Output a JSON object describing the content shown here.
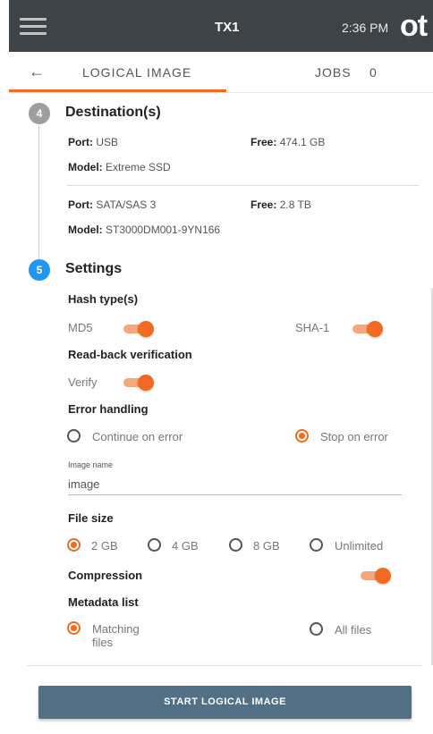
{
  "topbar": {
    "title": "TX1",
    "time": "2:36 PM",
    "logo": "ot"
  },
  "tabs": {
    "back_icon": "back-arrow-icon",
    "logical": "LOGICAL IMAGE",
    "jobs": "JOBS",
    "jobs_count": "0"
  },
  "destinations": {
    "step": "4",
    "title": "Destination(s)",
    "items": [
      {
        "port_label": "Port:",
        "port": "USB",
        "free_label": "Free:",
        "free": "474.1 GB",
        "model_label": "Model:",
        "model": "Extreme SSD"
      },
      {
        "port_label": "Port:",
        "port": "SATA/SAS 3",
        "free_label": "Free:",
        "free": "2.8 TB",
        "model_label": "Model:",
        "model": "ST3000DM001-9YN166"
      }
    ]
  },
  "settings": {
    "step": "5",
    "title": "Settings",
    "hash_heading": "Hash type(s)",
    "hash_md5": "MD5",
    "hash_sha1": "SHA-1",
    "readback_heading": "Read-back verification",
    "verify": "Verify",
    "error_heading": "Error handling",
    "continue_on_error": "Continue on error",
    "stop_on_error": "Stop on error",
    "image_name_caption": "Image name",
    "image_name_value": "image",
    "filesize_heading": "File size",
    "filesize_options": [
      "2 GB",
      "4 GB",
      "8 GB",
      "Unlimited"
    ],
    "filesize_selected": "2 GB",
    "compression_heading": "Compression",
    "metadata_heading": "Metadata list",
    "metadata_matching_1": "Matching",
    "metadata_matching_2": "files",
    "metadata_all": "All files",
    "toggles": {
      "md5": true,
      "sha1": true,
      "verify": true,
      "compression": true
    },
    "error_selected": "Stop on error",
    "metadata_selected": "Matching files"
  },
  "start_button": "START LOGICAL IMAGE",
  "colors": {
    "accent": "#f26a21",
    "topbar": "#3d4347",
    "button": "#527085",
    "step_active": "#2196f3",
    "step_done": "#9e9e9e"
  }
}
